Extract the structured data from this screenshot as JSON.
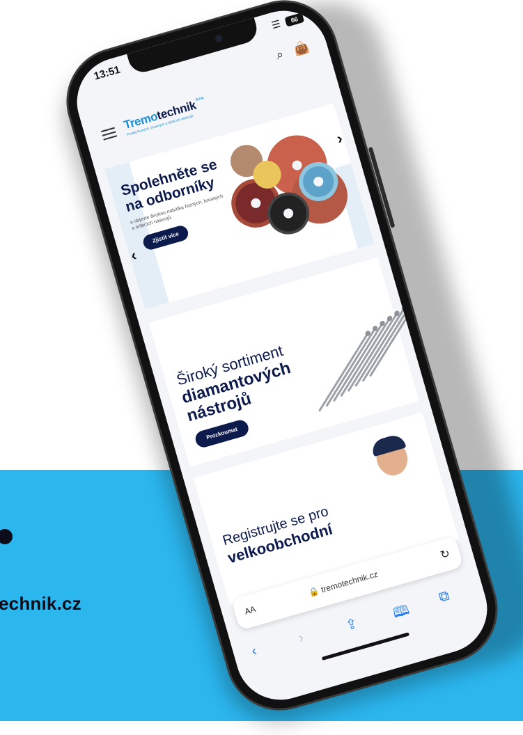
{
  "background": {
    "band_color": "#2bb6ee",
    "band_text": "echnik.cz"
  },
  "status_bar": {
    "time": "13:51",
    "battery": "66"
  },
  "header": {
    "logo_part1": "Tremo",
    "logo_part2": "technik",
    "logo_suffix": "s.r.o.",
    "logo_tagline": "Prodej řezných, brusných a lešticích nástrojů",
    "menu_icon": "hamburger-icon",
    "search_icon": "search-icon",
    "cart_icon": "shopping-bag-icon"
  },
  "hero": {
    "title": "Spolehněte se na odborníky",
    "description": "a objevte širokou nabídku řezných, brusných a lešticích nástrojů.",
    "button": "Zjistit více"
  },
  "promo": {
    "title_line1": "Široký sortiment",
    "title_line2": "diamantových nástrojů",
    "button": "Prozkoumat"
  },
  "registration": {
    "title_line1": "Registrujte se pro",
    "title_line2": "velkoobchodní"
  },
  "browser": {
    "text_size": "AA",
    "url": "tremotechnik.cz",
    "reload_icon": "reload-icon",
    "back_icon": "back-icon",
    "forward_icon": "forward-icon",
    "share_icon": "share-icon",
    "bookmarks_icon": "book-icon",
    "tabs_icon": "tabs-icon"
  },
  "colors": {
    "brand_navy": "#0d1b4c",
    "brand_blue": "#1a8fd6",
    "safari_blue": "#2a7ef0"
  }
}
